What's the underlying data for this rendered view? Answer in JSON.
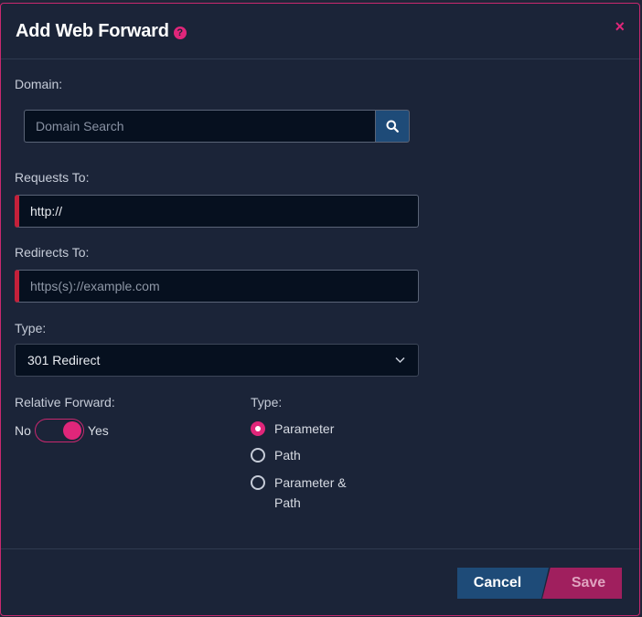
{
  "modal": {
    "title": "Add Web Forward",
    "help_icon": "?",
    "close_icon": "×"
  },
  "form": {
    "domain": {
      "label": "Domain:",
      "placeholder": "Domain Search",
      "value": ""
    },
    "requests_to": {
      "label": "Requests To:",
      "value": "http://"
    },
    "redirects_to": {
      "label": "Redirects To:",
      "placeholder": "https(s)://example.com",
      "value": ""
    },
    "type": {
      "label": "Type:",
      "selected": "301 Redirect"
    },
    "relative_forward": {
      "label": "Relative Forward:",
      "off_label": "No",
      "on_label": "Yes",
      "enabled": true
    },
    "forward_type": {
      "label": "Type:",
      "options": [
        {
          "label": "Parameter",
          "checked": true
        },
        {
          "label": "Path",
          "checked": false
        },
        {
          "label": "Parameter & Path",
          "checked": false
        }
      ]
    }
  },
  "footer": {
    "cancel_label": "Cancel",
    "save_label": "Save"
  },
  "colors": {
    "accent": "#e0267a",
    "primary_button": "#1e4b78",
    "save_button": "#a01f5e",
    "required_marker": "#c4203a",
    "background": "#1b2438",
    "input_background": "#06101f"
  },
  "icons": {
    "help": "help-circle-icon",
    "close": "close-icon",
    "search": "search-icon",
    "dropdown": "chevron-down-icon"
  }
}
